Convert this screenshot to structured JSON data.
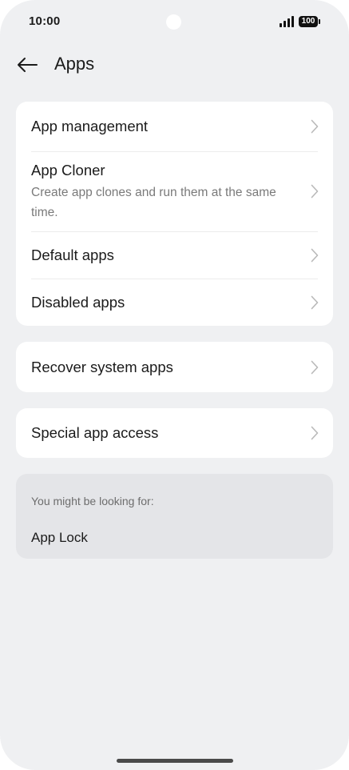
{
  "status_bar": {
    "time": "10:00",
    "battery": "100"
  },
  "header": {
    "title": "Apps"
  },
  "groups": [
    {
      "items": [
        {
          "title": "App management"
        },
        {
          "title": "App Cloner",
          "subtitle": "Create app clones and run them at the same time."
        },
        {
          "title": "Default apps"
        },
        {
          "title": "Disabled apps"
        }
      ]
    },
    {
      "items": [
        {
          "title": "Recover system apps"
        }
      ]
    },
    {
      "items": [
        {
          "title": "Special app access"
        }
      ]
    }
  ],
  "suggestions": {
    "label": "You might be looking for:",
    "items": [
      "App Lock"
    ]
  }
}
